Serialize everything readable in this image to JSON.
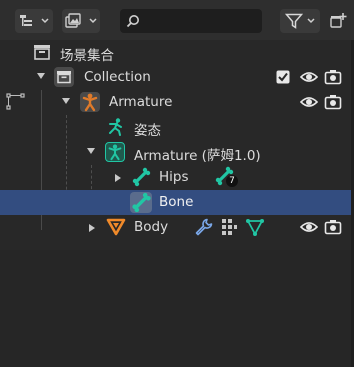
{
  "header": {
    "search": {
      "value": "",
      "placeholder": ""
    }
  },
  "tree": {
    "scene_collection": {
      "label": "场景集合"
    },
    "collection": {
      "label": "Collection"
    },
    "armature_object": {
      "label": "Armature"
    },
    "pose": {
      "label": "姿态"
    },
    "armature_data": {
      "label": "Armature (萨姆1.0)"
    },
    "hips": {
      "label": "Hips",
      "child_count": "7"
    },
    "bone": {
      "label": "Bone"
    },
    "body": {
      "label": "Body"
    }
  },
  "colors": {
    "background": "#282828",
    "selection": "#334d80",
    "armature_orange": "#e07b2a",
    "bone_green": "#21c6a4",
    "mesh_orange": "#f08a2a",
    "modifier_blue": "#7aa7e8"
  },
  "icons": [
    "display-mode-icon",
    "outliner-filter-icon",
    "search-icon",
    "funnel-icon",
    "new-collection-icon",
    "collection-icon",
    "armature-icon",
    "pose-icon",
    "armature-data-icon",
    "bone-icon",
    "mesh-triangle-icon",
    "wrench-icon",
    "vertex-groups-icon",
    "mesh-data-icon",
    "eye-icon",
    "camera-icon",
    "checkbox-icon"
  ]
}
